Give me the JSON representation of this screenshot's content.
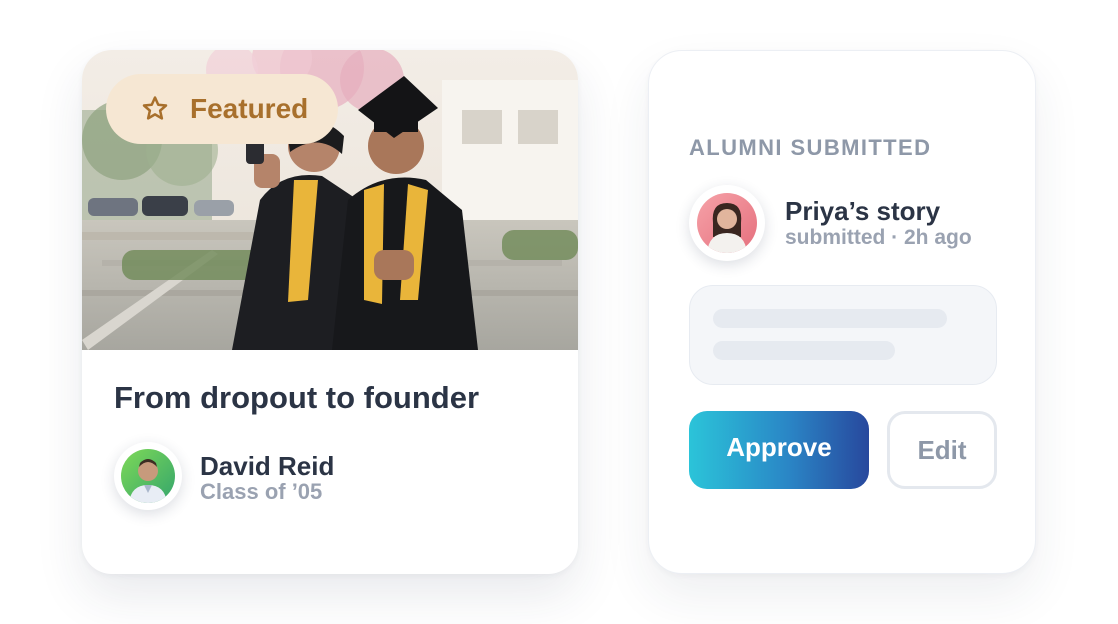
{
  "featured_card": {
    "badge_label": "Featured",
    "badge_icon": "star-outline-icon",
    "photo_subject": "graduation-selfie",
    "title": "From dropout to founder",
    "author": {
      "name": "David Reid",
      "class_year": "Class of ’05"
    }
  },
  "review_card": {
    "section_label": "ALUMNI SUBMITTED",
    "submission": {
      "owner": "Priya’s story",
      "meta": "submitted · 2h ago"
    },
    "actions": {
      "approve_label": "Approve",
      "edit_label": "Edit"
    }
  },
  "colors": {
    "badge_bg": "#f6e7d3",
    "badge_text": "#a8702c",
    "heading": "#2b3445",
    "muted": "#9aa2b1",
    "approve_gradient_start": "#2bc4d9",
    "approve_gradient_end": "#28489d"
  }
}
